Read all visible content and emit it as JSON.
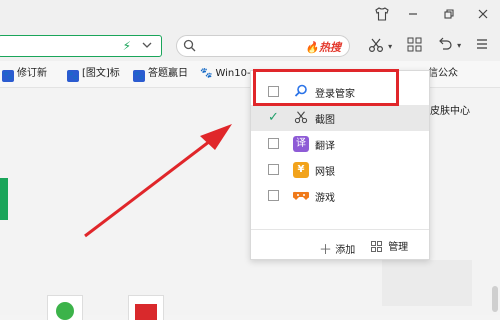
{
  "toolbar": {
    "hot_search_label": "热搜"
  },
  "bookmarks": [
    {
      "label": "修订新"
    },
    {
      "label": "[图文]标"
    },
    {
      "label": "答题赢日"
    },
    {
      "label": "Win10-"
    },
    {
      "label": "信公众"
    }
  ],
  "side_link": "皮肤中心",
  "dropdown": {
    "items": [
      {
        "label": "登录管家",
        "checked": false,
        "icon": "magnifier-icon"
      },
      {
        "label": "截图",
        "checked": true,
        "icon": "scissors-icon"
      },
      {
        "label": "翻译",
        "checked": false,
        "icon": "translate-icon",
        "icon_glyph": "译"
      },
      {
        "label": "网银",
        "checked": false,
        "icon": "yen-icon",
        "icon_glyph": "¥"
      },
      {
        "label": "游戏",
        "checked": false,
        "icon": "gamepad-icon"
      }
    ],
    "add_label": "添加",
    "manage_label": "管理"
  },
  "colors": {
    "accent_green": "#1aa55a",
    "highlight_red": "#e0262a",
    "hot_red": "#e3382c"
  }
}
